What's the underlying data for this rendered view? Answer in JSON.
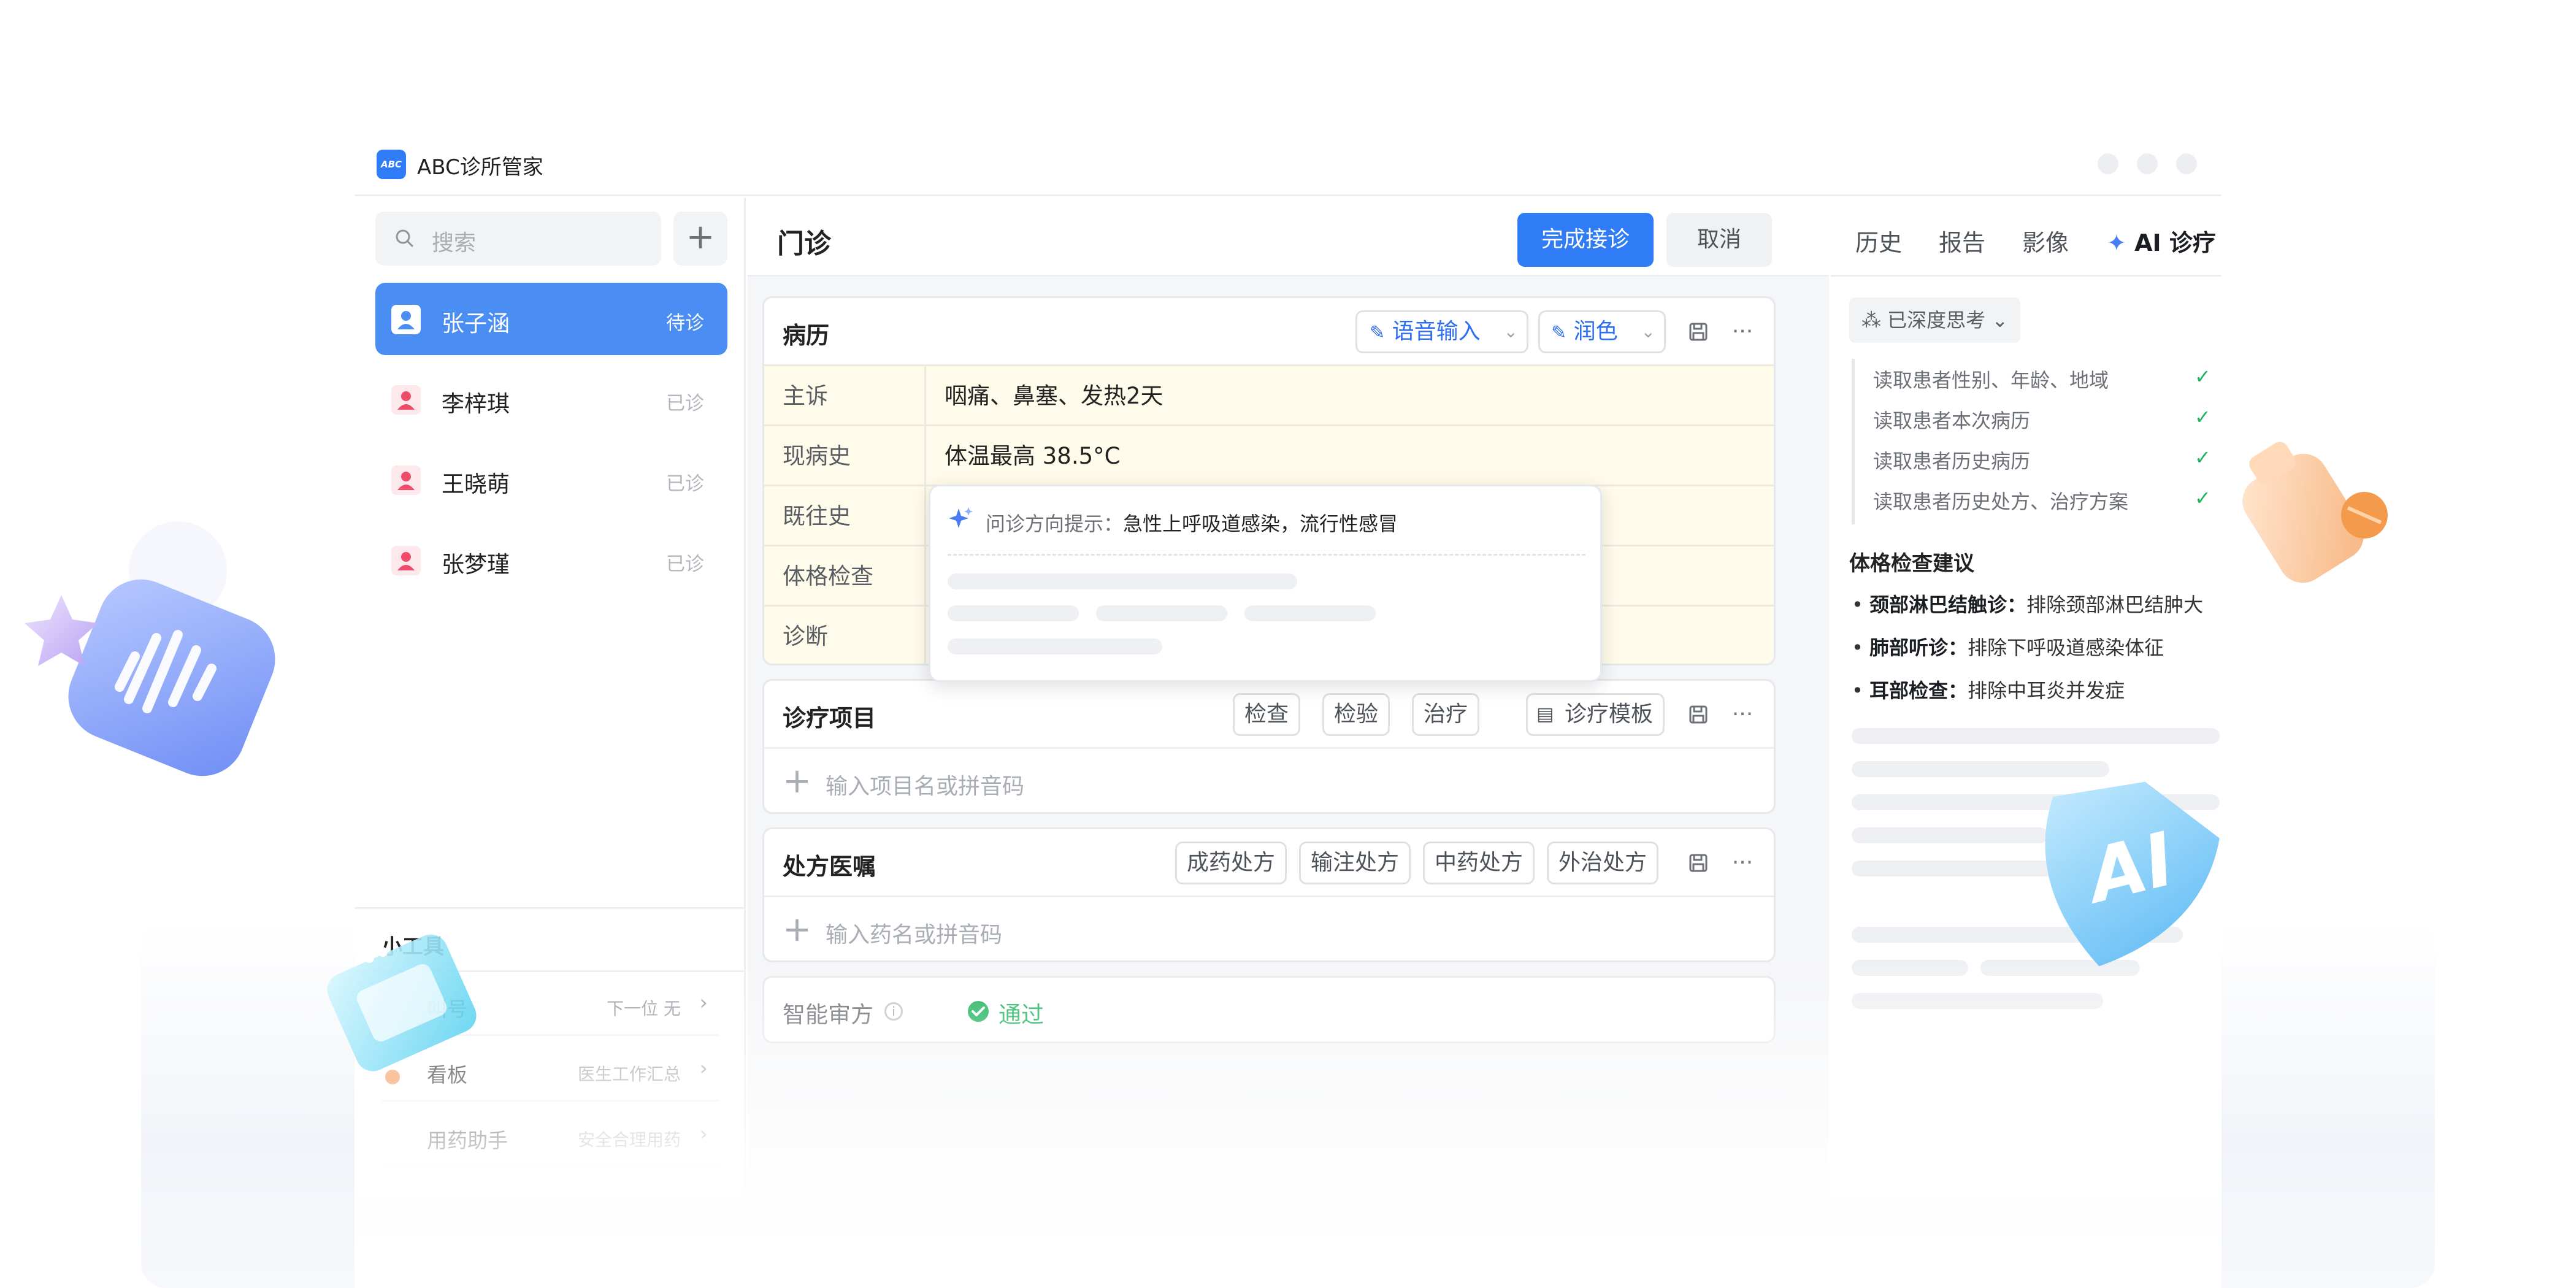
{
  "app": {
    "title": "ABC诊所管家",
    "logo_text": "ABC"
  },
  "sidebar": {
    "search_placeholder": "搜索",
    "add_label": "+",
    "patients": [
      {
        "name": "张子涵",
        "status": "待诊",
        "active": true
      },
      {
        "name": "李梓琪",
        "status": "已诊",
        "active": false
      },
      {
        "name": "王晓萌",
        "status": "已诊",
        "active": false
      },
      {
        "name": "张梦瑾",
        "status": "已诊",
        "active": false
      }
    ],
    "tools": {
      "title": "小工具",
      "items": [
        {
          "name": "叫号",
          "meta": "下一位 无"
        },
        {
          "name": "看板",
          "meta": "医生工作汇总"
        },
        {
          "name": "用药助手",
          "meta": "安全合理用药"
        }
      ]
    }
  },
  "main": {
    "title": "门诊",
    "complete_button": "完成接诊",
    "cancel_button": "取消",
    "record": {
      "title": "病历",
      "voice_input": "语音输入",
      "polish": "润色",
      "fields": [
        {
          "label": "主诉",
          "value": "咽痛、鼻塞、发热2天"
        },
        {
          "label": "现病史",
          "value": "体温最高 38.5°C"
        },
        {
          "label": "既往史",
          "value": ""
        },
        {
          "label": "体格检查",
          "value": ""
        },
        {
          "label": "诊断",
          "value": ""
        }
      ]
    },
    "hint": {
      "label": "问诊方向提示：",
      "text": "急性上呼吸道感染，流行性感冒"
    },
    "items": {
      "title": "诊疗项目",
      "buttons": [
        "检查",
        "检验",
        "治疗"
      ],
      "template_button": "诊疗模板",
      "input_placeholder": "输入项目名或拼音码"
    },
    "prescription": {
      "title": "处方医嘱",
      "buttons": [
        "成药处方",
        "输注处方",
        "中药处方",
        "外治处方"
      ],
      "input_placeholder": "输入药名或拼音码"
    },
    "review": {
      "label": "智能审方",
      "status": "通过"
    }
  },
  "right": {
    "tabs": [
      "历史",
      "报告",
      "影像",
      "AI 诊疗"
    ],
    "active_tab": "AI 诊疗",
    "thinking_chip": "已深度思考",
    "steps": [
      "读取患者性别、年龄、地域",
      "读取患者本次病历",
      "读取患者历史病历",
      "读取患者历史处方、治疗方案"
    ],
    "section_title": "体格检查建议",
    "suggestions": [
      {
        "name": "颈部淋巴结触诊：",
        "text": "排除颈部淋巴结肿大"
      },
      {
        "name": "肺部听诊：",
        "text": "排除下呼吸道感染体征"
      },
      {
        "name": "耳部检查：",
        "text": "排除中耳炎并发症"
      }
    ]
  },
  "decorations": {
    "ai_badge_text": "AI"
  },
  "colors": {
    "accent": "#2f7cf6",
    "active_patient": "#4a8df3",
    "record_bg": "#fffbea",
    "success": "#22b35e"
  }
}
